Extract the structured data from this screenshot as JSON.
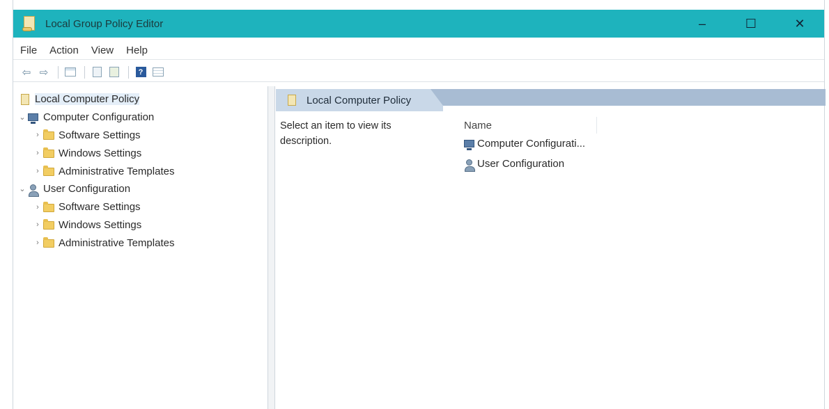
{
  "window": {
    "title": "Local Group Policy Editor",
    "title_icon": "policy-scroll-icon",
    "controls": {
      "minimize": "–",
      "maximize": "☐",
      "close": "✕"
    },
    "accent_color": "#1eb3bd"
  },
  "menu": {
    "items": [
      "File",
      "Action",
      "View",
      "Help"
    ]
  },
  "toolbar": {
    "buttons": [
      "back-arrow-icon",
      "forward-arrow-icon",
      "show-hide-tree-icon",
      "properties-icon",
      "export-list-icon",
      "help-icon",
      "extended-view-icon"
    ],
    "back": "⇦",
    "forward": "⇨",
    "help": "?"
  },
  "tree": {
    "root": "Local Computer Policy",
    "computer": {
      "label": "Computer Configuration",
      "children": [
        "Software Settings",
        "Windows Settings",
        "Administrative Templates"
      ]
    },
    "user": {
      "label": "User Configuration",
      "children": [
        "Software Settings",
        "Windows Settings",
        "Administrative Templates"
      ]
    },
    "expanded_glyph": "⌄",
    "collapsed_glyph": "›"
  },
  "details": {
    "header_title": "Local Computer Policy",
    "description": "Select an item to view its description.",
    "column_name": "Name",
    "items": [
      "Computer Configurati...",
      "User Configuration"
    ]
  }
}
